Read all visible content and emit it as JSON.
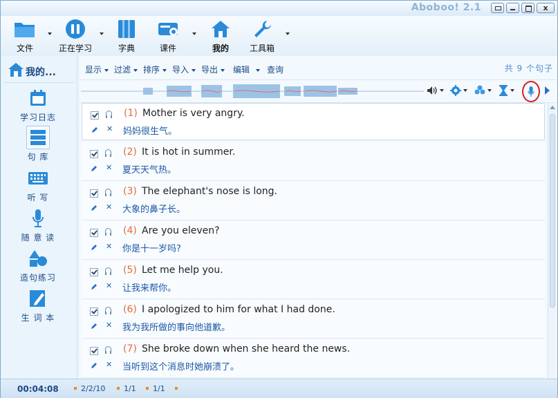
{
  "app_title": "Aboboo! 2.1",
  "window_buttons": {
    "close": "x"
  },
  "toolbar": [
    {
      "label": "文件",
      "icon": "folder-icon",
      "bold": false
    },
    {
      "label": "正在学习",
      "icon": "pause-icon",
      "bold": false
    },
    {
      "label": "字典",
      "icon": "book-icon",
      "bold": false
    },
    {
      "label": "课件",
      "icon": "disc-drive-icon",
      "bold": false
    },
    {
      "label": "我的",
      "icon": "home-icon",
      "bold": true
    },
    {
      "label": "工具箱",
      "icon": "wrench-icon",
      "bold": false
    }
  ],
  "sidebar": {
    "header": "我的...",
    "items": [
      {
        "label": "学习日志",
        "icon": "calendar-icon",
        "selected": false
      },
      {
        "label": "句 库",
        "icon": "list-icon",
        "selected": true
      },
      {
        "label": "听 写",
        "icon": "keyboard-icon",
        "selected": false
      },
      {
        "label": "随 意 读",
        "icon": "microphone-icon",
        "selected": false
      },
      {
        "label": "造句练习",
        "icon": "shapes-icon",
        "selected": false
      },
      {
        "label": "生 词 本",
        "icon": "notebook-pencil-icon",
        "selected": false
      }
    ]
  },
  "menu": {
    "items": [
      "显示",
      "过滤",
      "排序",
      "导入",
      "导出",
      "编辑",
      "查询"
    ],
    "count": "共 9 个句子"
  },
  "colors": {
    "accent": "#2a6fc7",
    "number": "#e36b3a",
    "chinese": "#1c58a6",
    "highlight_circle": "#d51f1f",
    "status_dot": "#f08a1f"
  },
  "sentences": [
    {
      "num": "(1)",
      "en": "Mother is very angry.",
      "cn": "妈妈很生气。"
    },
    {
      "num": "(2)",
      "en": "It is hot in summer.",
      "cn": "夏天天气热。"
    },
    {
      "num": "(3)",
      "en": "The elephant's nose is long.",
      "cn": "大象的鼻子长。"
    },
    {
      "num": "(4)",
      "en": "Are you eleven?",
      "cn": "你是十一岁吗?"
    },
    {
      "num": "(5)",
      "en": "Let me help you.",
      "cn": "让我来帮你。"
    },
    {
      "num": "(6)",
      "en": "I apologized to him for what I had done.",
      "cn": "我为我所做的事向他道歉。"
    },
    {
      "num": "(7)",
      "en": "She broke down when she heard the news.",
      "cn": "当听到这个消息时她崩溃了。"
    }
  ],
  "status": {
    "time": "00:04:08",
    "fields": [
      "2/2/10",
      "1/1",
      "1/1"
    ]
  }
}
